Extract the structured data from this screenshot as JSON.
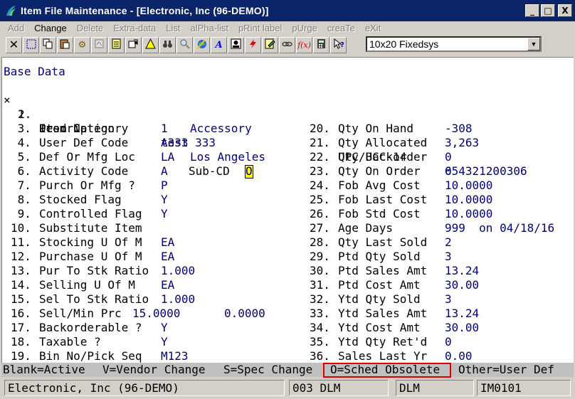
{
  "window": {
    "title": "Item File Maintenance - [Electronic, Inc (96-DEMO)]",
    "buttons": [
      "_",
      "□",
      "X"
    ]
  },
  "menu": [
    {
      "label": "Add",
      "enabled": false
    },
    {
      "label": "Change",
      "enabled": true
    },
    {
      "label": "Delete",
      "enabled": false
    },
    {
      "label": "Extra-data",
      "enabled": false
    },
    {
      "label": "List",
      "enabled": false
    },
    {
      "label": "alPha-list",
      "enabled": false
    },
    {
      "label": "pRint label",
      "enabled": false
    },
    {
      "label": "pUrge",
      "enabled": false
    },
    {
      "label": "creaTe",
      "enabled": false
    },
    {
      "label": "eXit",
      "enabled": false
    }
  ],
  "toolbar": {
    "icons": [
      "close-x-icon",
      "select-rect-icon",
      "copy-icon",
      "paste-icon",
      "gear-icon",
      "properties-icon",
      "notepad-icon",
      "stamp-icon",
      "alert-icon",
      "binoculars-icon",
      "magnifier-icon",
      "globe-icon",
      "script-icon",
      "contact-icon",
      "lightning-icon",
      "edit-doc-icon",
      "link-icon",
      "function-icon",
      "calculator-icon",
      "help-pointer-icon"
    ],
    "font_select": "10x20 Fixedsys"
  },
  "screen": {
    "section": "Base Data",
    "marker": "×",
    "top_fields": [
      {
        "num": "1.",
        "label": "Item No",
        "value": "A333",
        "rlabel": "UPC/UCC-14",
        "rvalue": "654321200306"
      },
      {
        "num": "2.",
        "label": "Description",
        "value": "test 333"
      }
    ],
    "left_fields": [
      {
        "num": " 3.",
        "label": "Prod Category",
        "value": "1",
        "extra": "Accessory"
      },
      {
        "num": " 4.",
        "label": "User Def Code",
        "value": "",
        "extra": ""
      },
      {
        "num": " 5.",
        "label": "Def Or Mfg Loc",
        "value": "LA",
        "extra": "Los Angeles"
      },
      {
        "num": " 6.",
        "label": "Activity Code",
        "value": "A",
        "extra": ""
      },
      {
        "num": " 7.",
        "label": "Purch Or Mfg ?",
        "value": "P",
        "extra": ""
      },
      {
        "num": " 8.",
        "label": "Stocked Flag",
        "value": "Y",
        "extra": ""
      },
      {
        "num": " 9.",
        "label": "Controlled Flag",
        "value": "Y",
        "extra": ""
      },
      {
        "num": "10.",
        "label": "Substitute Item",
        "value": "",
        "extra": ""
      },
      {
        "num": "11.",
        "label": "Stocking U Of M",
        "value": "EA",
        "extra": ""
      },
      {
        "num": "12.",
        "label": "Purchase U Of M",
        "value": "EA",
        "extra": ""
      },
      {
        "num": "13.",
        "label": "Pur To Stk Ratio",
        "value": "1.000",
        "extra": ""
      },
      {
        "num": "14.",
        "label": "Selling U Of M",
        "value": "EA",
        "extra": ""
      },
      {
        "num": "15.",
        "label": "Sel To Stk Ratio",
        "value": "1.000",
        "extra": ""
      },
      {
        "num": "16.",
        "label": "Sell/Min Prc",
        "value": "15.0000",
        "extra": "0.0000"
      },
      {
        "num": "17.",
        "label": "Backorderable ?",
        "value": "Y",
        "extra": ""
      },
      {
        "num": "18.",
        "label": "Taxable ?",
        "value": "Y",
        "extra": ""
      },
      {
        "num": "19.",
        "label": "Bin No/Pick Seq",
        "value": "M123",
        "extra": ""
      }
    ],
    "sub_cd": {
      "label": "Sub-CD",
      "value": "O"
    },
    "right_fields": [
      {
        "num": "20.",
        "label": "Qty On Hand",
        "value": "-308"
      },
      {
        "num": "21.",
        "label": "Qty Allocated",
        "value": "3,263"
      },
      {
        "num": "22.",
        "label": "Qty Backorder",
        "value": "0"
      },
      {
        "num": "23.",
        "label": "Qty On Order",
        "value": "0"
      },
      {
        "num": "24.",
        "label": "Fob Avg Cost",
        "value": "10.0000"
      },
      {
        "num": "25.",
        "label": "Fob Last Cost",
        "value": "10.0000"
      },
      {
        "num": "26.",
        "label": "Fob Std Cost",
        "value": "10.0000"
      },
      {
        "num": "27.",
        "label": "Age Days",
        "value": "999  on 04/18/16"
      },
      {
        "num": "28.",
        "label": "Qty Last Sold",
        "value": "2"
      },
      {
        "num": "29.",
        "label": "Ptd Qty Sold",
        "value": "3"
      },
      {
        "num": "30.",
        "label": "Ptd Sales Amt",
        "value": "13.24"
      },
      {
        "num": "31.",
        "label": "Ptd Cost Amt",
        "value": "30.00"
      },
      {
        "num": "32.",
        "label": "Ytd Qty Sold",
        "value": "3"
      },
      {
        "num": "33.",
        "label": "Ytd Sales Amt",
        "value": "13.24"
      },
      {
        "num": "34.",
        "label": "Ytd Cost Amt",
        "value": "30.00"
      },
      {
        "num": "35.",
        "label": "Ytd Qty Ret'd",
        "value": "0"
      },
      {
        "num": "36.",
        "label": "Sales Last Yr",
        "value": "0.00"
      }
    ],
    "status_help": {
      "blank": "Blank=Active",
      "vendor": "V=Vendor Change",
      "spec": "S=Spec Change",
      "sched": "O=Sched Obsolete",
      "other": "Other=User Def"
    }
  },
  "bottom": {
    "company": "Electronic, Inc (96-DEMO)",
    "user": "003 DLM",
    "user2": "DLM",
    "program": "IM0101"
  },
  "colors": {
    "titlebar": "#0a246a",
    "value_text": "#00007f",
    "highlight_box": "#e00000"
  }
}
